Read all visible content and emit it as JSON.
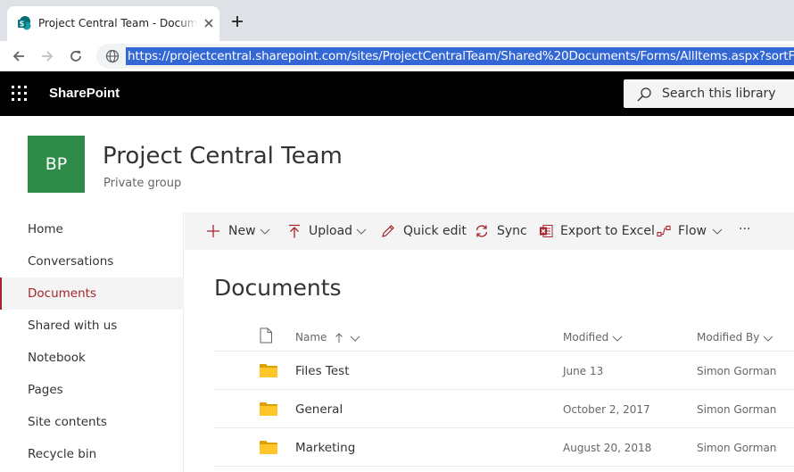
{
  "browser": {
    "tab_title": "Project Central Team - Documents",
    "url": "https://projectcentral.sharepoint.com/sites/ProjectCentralTeam/Shared%20Documents/Forms/AllItems.aspx?sortField"
  },
  "suite": {
    "brand": "SharePoint",
    "search_placeholder": "Search this library"
  },
  "site": {
    "logo_initials": "BP",
    "logo_color": "#2e8b48",
    "title": "Project Central Team",
    "subtitle": "Private group"
  },
  "nav": {
    "items": [
      {
        "label": "Home"
      },
      {
        "label": "Conversations"
      },
      {
        "label": "Documents",
        "active": true
      },
      {
        "label": "Shared with us"
      },
      {
        "label": "Notebook"
      },
      {
        "label": "Pages"
      },
      {
        "label": "Site contents"
      },
      {
        "label": "Recycle bin"
      }
    ],
    "active_color": "#a4262c"
  },
  "commands": {
    "new": "New",
    "upload": "Upload",
    "quick_edit": "Quick edit",
    "sync": "Sync",
    "export": "Export to Excel",
    "flow": "Flow",
    "more": "···"
  },
  "library": {
    "title": "Documents",
    "columns": {
      "name": "Name",
      "modified": "Modified",
      "modified_by": "Modified By"
    },
    "rows": [
      {
        "name": "Files Test",
        "modified": "June 13",
        "modified_by": "Simon Gorman"
      },
      {
        "name": "General",
        "modified": "October 2, 2017",
        "modified_by": "Simon Gorman"
      },
      {
        "name": "Marketing",
        "modified": "August 20, 2018",
        "modified_by": "Simon Gorman"
      }
    ]
  }
}
